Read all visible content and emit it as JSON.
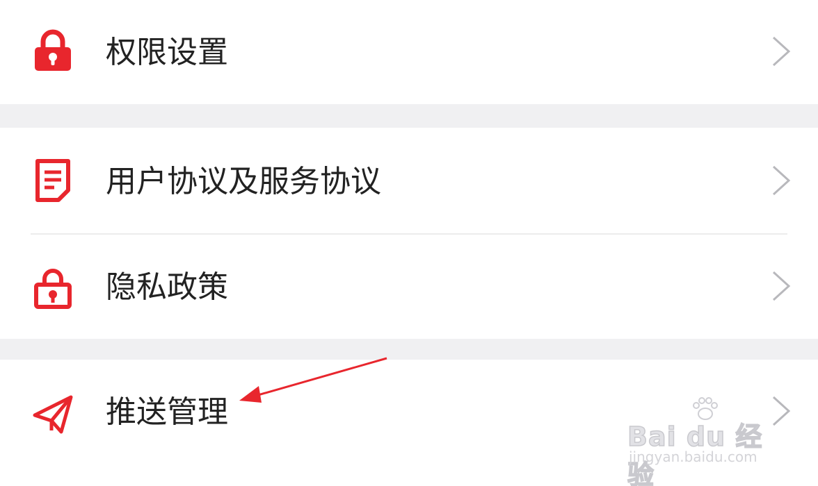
{
  "settings": {
    "items": [
      {
        "label": "权限设置",
        "icon": "lock-icon"
      },
      {
        "label": "用户协议及服务协议",
        "icon": "document-icon"
      },
      {
        "label": "隐私政策",
        "icon": "privacy-lock-icon"
      },
      {
        "label": "推送管理",
        "icon": "paper-plane-icon"
      }
    ]
  },
  "watermark": {
    "brand": "Bai du 经验",
    "site": "jingyan.baidu.com"
  },
  "colors": {
    "accent": "#e8262d",
    "text": "#222222",
    "chevron": "#b8b8bc",
    "section_gap": "#f0f0f2",
    "annotation_arrow": "#e8262d"
  }
}
